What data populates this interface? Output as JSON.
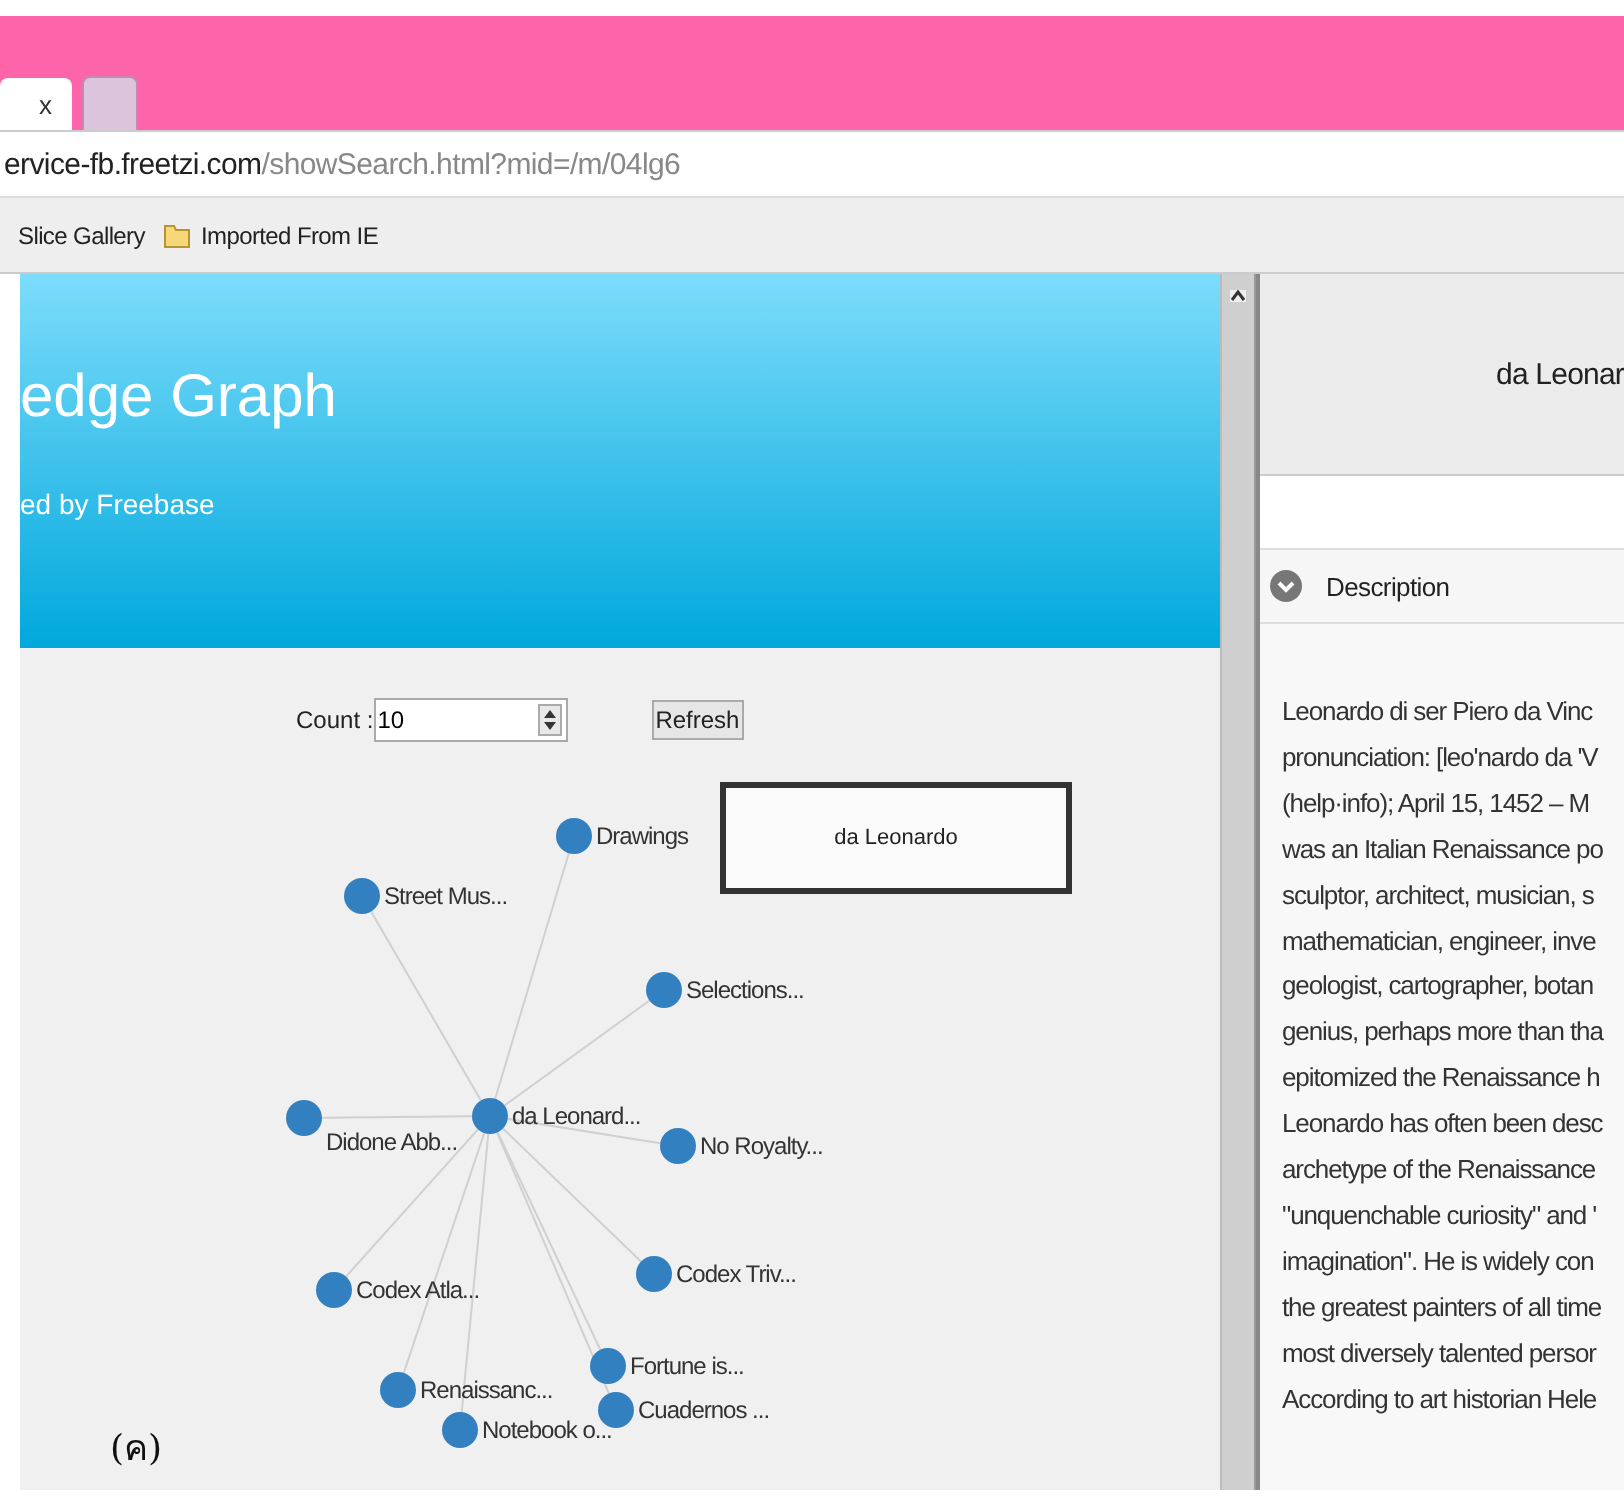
{
  "browser": {
    "tabs": [
      {
        "close": "x",
        "selected": true
      },
      {
        "selected": false
      }
    ],
    "address": {
      "host": "ervice-fb.freetzi.com",
      "path": "/showSearch.html?mid=/m/04lg6"
    },
    "bookmarks": [
      {
        "label": "Slice Gallery",
        "kind": "plain"
      },
      {
        "label": "Imported From IE",
        "kind": "folder"
      }
    ]
  },
  "header": {
    "title": "edge Graph",
    "subtitle": "ed by Freebase"
  },
  "controls": {
    "count_label": "Count :",
    "count_value": "10",
    "refresh": "Refresh"
  },
  "graph": {
    "center": "da Leonard...",
    "nodes": [
      "Drawings",
      "Street Mus...",
      "Selections...",
      "Didone Abb...",
      "No Royalty...",
      "Codex Triv...",
      "Codex Atla...",
      "Fortune is...",
      "Renaissanc...",
      "Notebook o...",
      "Cuadernos ..."
    ],
    "tooltip": "da Leonardo"
  },
  "caption": "(ค)",
  "panel": {
    "title": "da Leonar",
    "section": "Description",
    "lines": [
      "Leonardo di ser Piero da Vinc",
      "pronunciation: [leo'nardo da 'V",
      "(help·info); April 15, 1452 – M",
      "was an Italian Renaissance po",
      "sculptor, architect, musician, s",
      "mathematician, engineer, inve",
      "geologist, cartographer, botan",
      "genius, perhaps more than tha",
      "epitomized the Renaissance h",
      "Leonardo has often been desc",
      "archetype of the Renaissance",
      "\"unquenchable curiosity\" and '",
      "imagination\". He is widely con",
      "the greatest painters of all time",
      "most diversely talented persor",
      "According to art historian Hele"
    ]
  }
}
